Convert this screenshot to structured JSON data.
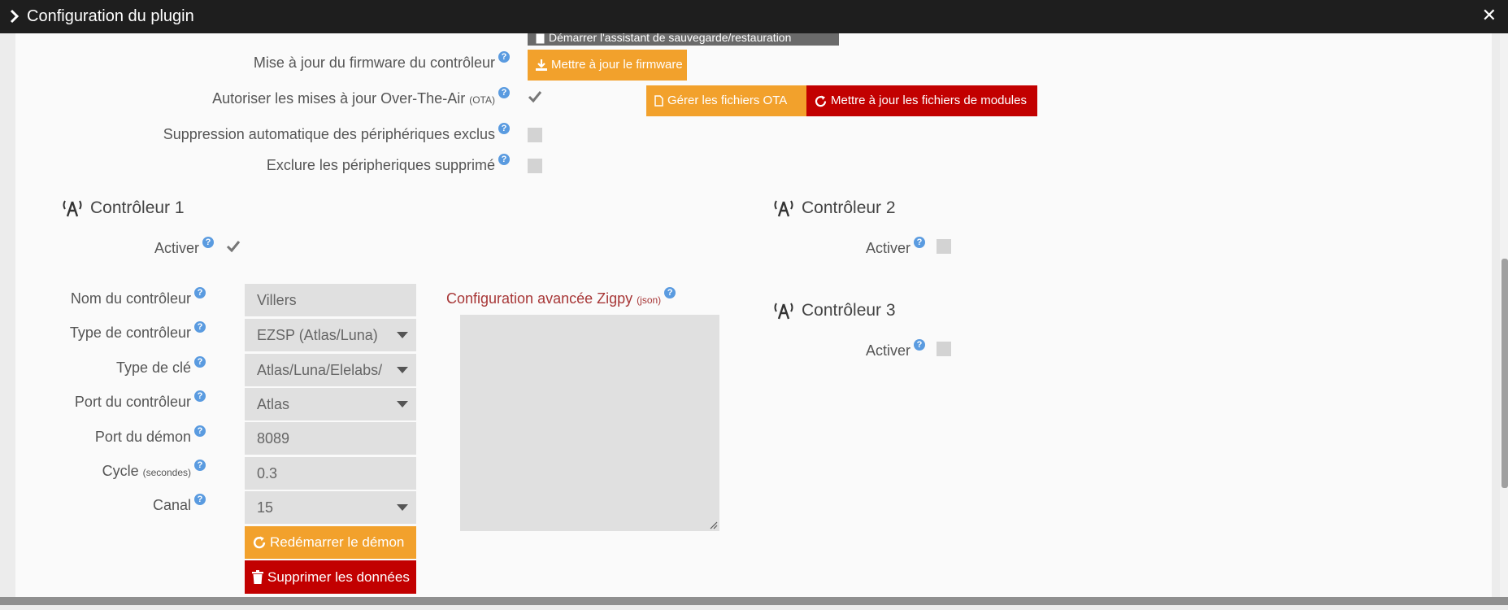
{
  "window": {
    "title": "Configuration du plugin"
  },
  "top_partial_button": "Démarrer l'assistant de sauvegarde/restauration",
  "settings": {
    "firmware_label": "Mise à jour du firmware du contrôleur",
    "firmware_button": "Mettre à jour le firmware",
    "ota_label": "Autoriser les mises à jour Over-The-Air",
    "ota_suffix": "(OTA)",
    "ota_files_button": "Gérer les fichiers OTA",
    "modules_button": "Mettre à jour les fichiers de modules",
    "auto_delete_label": "Suppression automatique des périphériques exclus",
    "exclude_deleted_label": "Exclure les péripheriques supprimé"
  },
  "controller1": {
    "title": "Contrôleur 1",
    "activate_label": "Activer",
    "fields": {
      "name_label": "Nom du contrôleur",
      "name_value": "Villers",
      "type_label": "Type de contrôleur",
      "type_value": "EZSP (Atlas/Luna)",
      "key_label": "Type de clé",
      "key_value": "Atlas/Luna/Elelabs/",
      "port_label": "Port du contrôleur",
      "port_value": "Atlas",
      "daemon_port_label": "Port du démon",
      "daemon_port_value": "8089",
      "cycle_label": "Cycle",
      "cycle_suffix": "(secondes)",
      "cycle_value": "0.3",
      "channel_label": "Canal",
      "channel_value": "15"
    },
    "restart_button": "Redémarrer le démon",
    "delete_button": "Supprimer les données",
    "zigpy_label": "Configuration avancée Zigpy",
    "zigpy_suffix": "(json)"
  },
  "controller2": {
    "title": "Contrôleur 2",
    "activate_label": "Activer"
  },
  "controller3": {
    "title": "Contrôleur 3",
    "activate_label": "Activer"
  },
  "help_glyph": "?"
}
